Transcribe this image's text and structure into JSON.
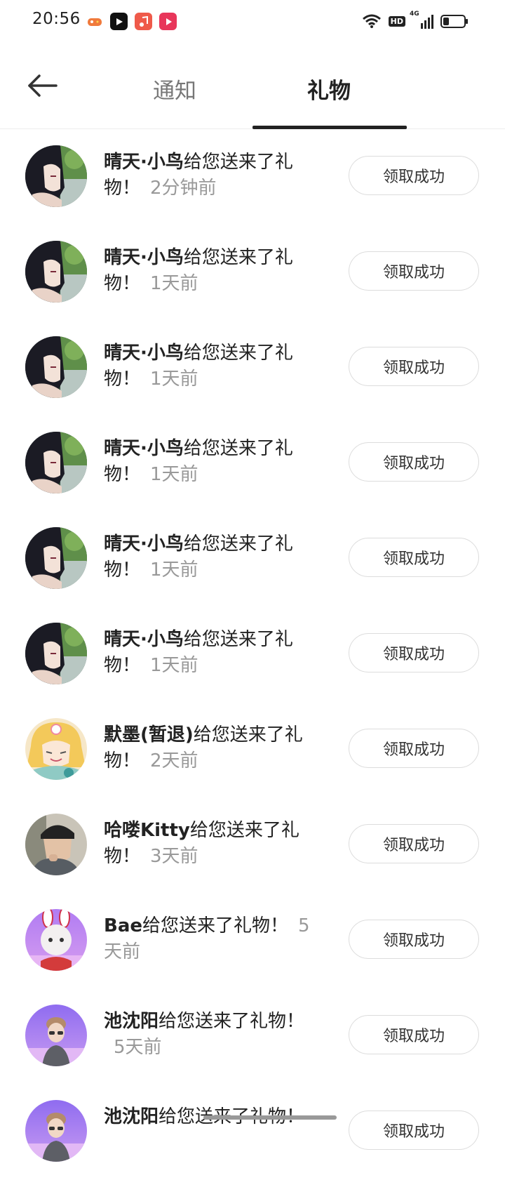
{
  "status_bar": {
    "time": "20:56",
    "network": "4G",
    "hd_label": "HD",
    "battery_level": 0.3,
    "app_icons": [
      "game-icon",
      "video-app-icon",
      "music-app-icon",
      "play-app-icon"
    ]
  },
  "header": {
    "tabs": [
      {
        "label": "通知",
        "active": false
      },
      {
        "label": "礼物",
        "active": true
      }
    ]
  },
  "gifts": [
    {
      "name": "晴天·小鸟",
      "action": "给您送来了礼物！",
      "time": "2分钟前",
      "button": "领取成功",
      "avatar": "anime-girl"
    },
    {
      "name": "晴天·小鸟",
      "action": "给您送来了礼物！",
      "time": "1天前",
      "button": "领取成功",
      "avatar": "anime-girl"
    },
    {
      "name": "晴天·小鸟",
      "action": "给您送来了礼物！",
      "time": "1天前",
      "button": "领取成功",
      "avatar": "anime-girl"
    },
    {
      "name": "晴天·小鸟",
      "action": "给您送来了礼物！",
      "time": "1天前",
      "button": "领取成功",
      "avatar": "anime-girl"
    },
    {
      "name": "晴天·小鸟",
      "action": "给您送来了礼物！",
      "time": "1天前",
      "button": "领取成功",
      "avatar": "anime-girl"
    },
    {
      "name": "晴天·小鸟",
      "action": "给您送来了礼物！",
      "time": "1天前",
      "button": "领取成功",
      "avatar": "anime-girl"
    },
    {
      "name": "默墨(暂退)",
      "action": "给您送来了礼物！",
      "time": "2天前",
      "button": "领取成功",
      "avatar": "blonde-anime"
    },
    {
      "name": "哈喽Kitty",
      "action": "给您送来了礼物！",
      "time": "3天前",
      "button": "领取成功",
      "avatar": "photo-man"
    },
    {
      "name": "Bae",
      "action": "给您送来了礼物！",
      "time": "5天前",
      "button": "领取成功",
      "avatar": "purple-bunny"
    },
    {
      "name": "池沈阳",
      "action": "给您送来了礼物！",
      "time": "5天前",
      "button": "领取成功",
      "avatar": "purple-man"
    },
    {
      "name": "池沈阳",
      "action": "给您送来了礼物！",
      "time": "",
      "button": "领取成功",
      "avatar": "purple-man"
    }
  ]
}
